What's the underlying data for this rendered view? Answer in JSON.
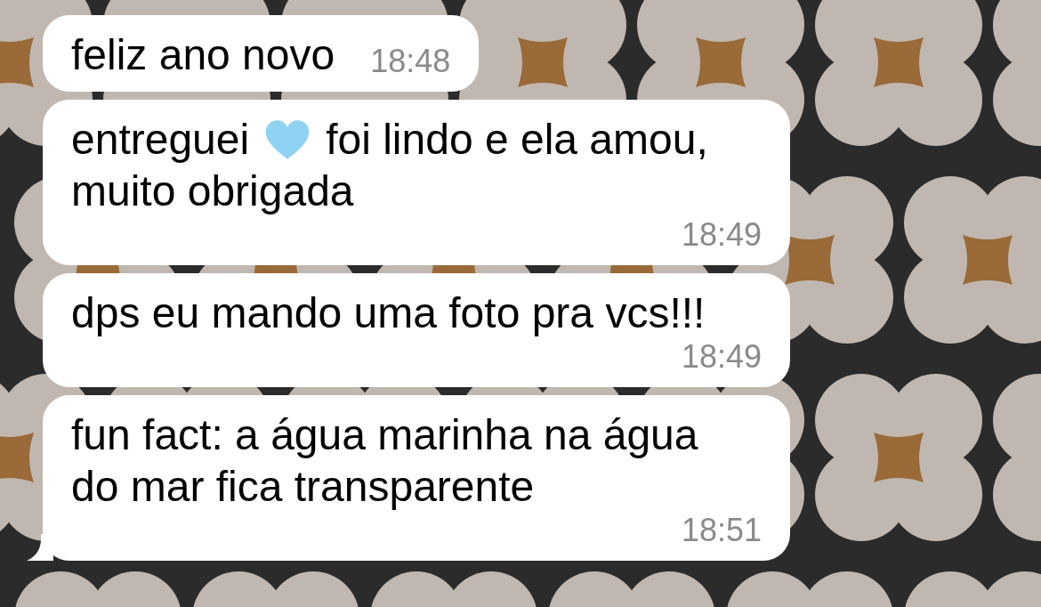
{
  "messages": [
    {
      "segments": [
        {
          "kind": "text",
          "text": "feliz ano novo"
        }
      ],
      "time": "18:48",
      "tail": false
    },
    {
      "segments": [
        {
          "kind": "text",
          "text": "entreguei"
        },
        {
          "kind": "emoji"
        },
        {
          "kind": "text",
          "text": "foi lindo e ela amou,"
        },
        {
          "kind": "break"
        },
        {
          "kind": "text",
          "text": "muito obrigada"
        }
      ],
      "time": "18:49",
      "tail": false
    },
    {
      "segments": [
        {
          "kind": "text",
          "text": "dps eu mando uma foto pra vcs!!!"
        }
      ],
      "time": "18:49",
      "tail": false
    },
    {
      "segments": [
        {
          "kind": "text",
          "text": "fun fact: a água marinha na água do mar fica transparente"
        }
      ],
      "time": "18:51",
      "tail": true
    }
  ]
}
